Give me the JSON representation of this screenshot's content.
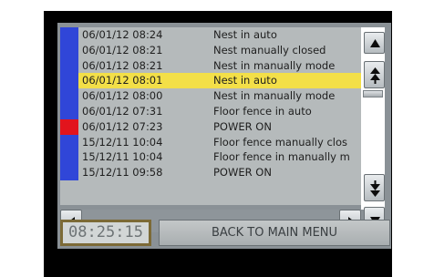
{
  "events": [
    {
      "date": "06/01/12 08:24",
      "text": "Nest in auto",
      "marker": "blue",
      "selected": false
    },
    {
      "date": "06/01/12 08:21",
      "text": "Nest manually closed",
      "marker": "blue",
      "selected": false
    },
    {
      "date": "06/01/12 08:21",
      "text": "Nest in manually mode",
      "marker": "blue",
      "selected": false
    },
    {
      "date": "06/01/12 08:01",
      "text": "Nest in auto",
      "marker": "blue",
      "selected": true
    },
    {
      "date": "06/01/12 08:00",
      "text": "Nest in manually mode",
      "marker": "blue",
      "selected": false
    },
    {
      "date": "06/01/12 07:31",
      "text": "Floor fence in auto",
      "marker": "blue",
      "selected": false
    },
    {
      "date": "06/01/12 07:23",
      "text": "POWER ON",
      "marker": "red",
      "selected": false
    },
    {
      "date": "15/12/11 10:04",
      "text": "Floor fence manually clos",
      "marker": "blue",
      "selected": false
    },
    {
      "date": "15/12/11 10:04",
      "text": "Floor fence in manually m",
      "marker": "blue",
      "selected": false
    },
    {
      "date": "15/12/11 09:58",
      "text": "POWER ON",
      "marker": "blue",
      "selected": false
    }
  ],
  "clock": "08:25:15",
  "back_button_label": "BACK TO MAIN MENU",
  "icons": {
    "scroll_up": "triangle-up-icon",
    "page_up": "double-arrow-up-icon",
    "page_down": "double-arrow-down-icon",
    "scroll_down": "triangle-down-icon",
    "scroll_left": "triangle-left-icon",
    "scroll_right": "triangle-right-icon"
  },
  "colors": {
    "marker_blue": "#3046d8",
    "marker_red": "#e2141d",
    "selected_row": "#f3df48"
  }
}
